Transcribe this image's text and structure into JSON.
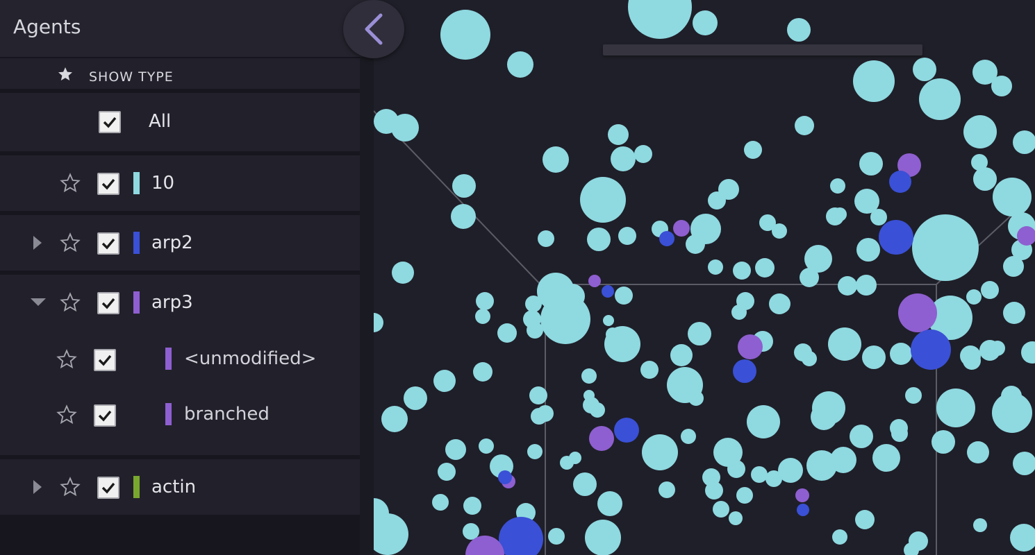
{
  "panel": {
    "title": "Agents",
    "show_type_label": "SHOW TYPE",
    "all_label": "All",
    "agents": [
      {
        "label": "10",
        "color": "#8fd9e0",
        "expandable": false
      },
      {
        "label": "arp2",
        "color": "#3a50d6",
        "expandable": true,
        "expanded": false
      },
      {
        "label": "arp3",
        "color": "#8e5fd0",
        "expandable": true,
        "expanded": true,
        "children": [
          {
            "label": "<unmodified>",
            "color": "#8e5fd0"
          },
          {
            "label": "branched",
            "color": "#8e5fd0"
          }
        ]
      },
      {
        "label": "actin",
        "color": "#79a82e",
        "expandable": true,
        "expanded": false
      }
    ]
  },
  "colors": {
    "agent_10": "#8fd9e0",
    "arp2": "#3a50d6",
    "arp3": "#8e5fd0",
    "actin": "#79a82e",
    "background": "#1f1f29"
  },
  "icons": {
    "collapse": "chevron-left-icon",
    "star": "star-outline-icon",
    "show_type": "star-filled-icon"
  }
}
